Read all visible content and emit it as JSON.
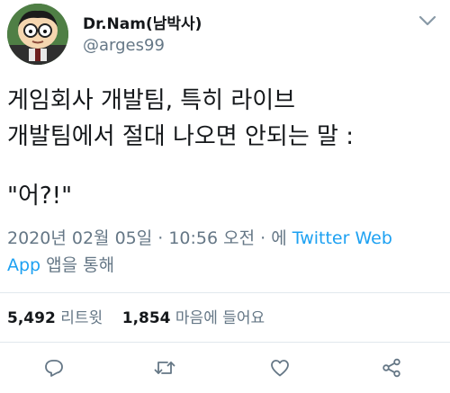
{
  "user": {
    "display_name": "Dr.Nam(남박사)",
    "handle": "@arges99"
  },
  "tweet": {
    "line1": "게임회사 개발팀, 특히 라이브",
    "line2": "개발팀에서 절대 나오면 안되는 말 :",
    "quote": "\"어?!\"",
    "timestamp": "2020년 02월 05일 · 10:56 오전 · 에",
    "source_link_part1": "Twitter Web",
    "source_link_part2": "App",
    "source_suffix": "앱을 통해"
  },
  "stats": {
    "retweet_count": "5,492",
    "retweet_label": "리트윗",
    "like_count": "1,854",
    "like_label": "마음에 들어요"
  },
  "colors": {
    "link": "#1da1f2",
    "secondary_text": "#657786",
    "primary_text": "#14171a",
    "divider": "#e1e8ed"
  }
}
